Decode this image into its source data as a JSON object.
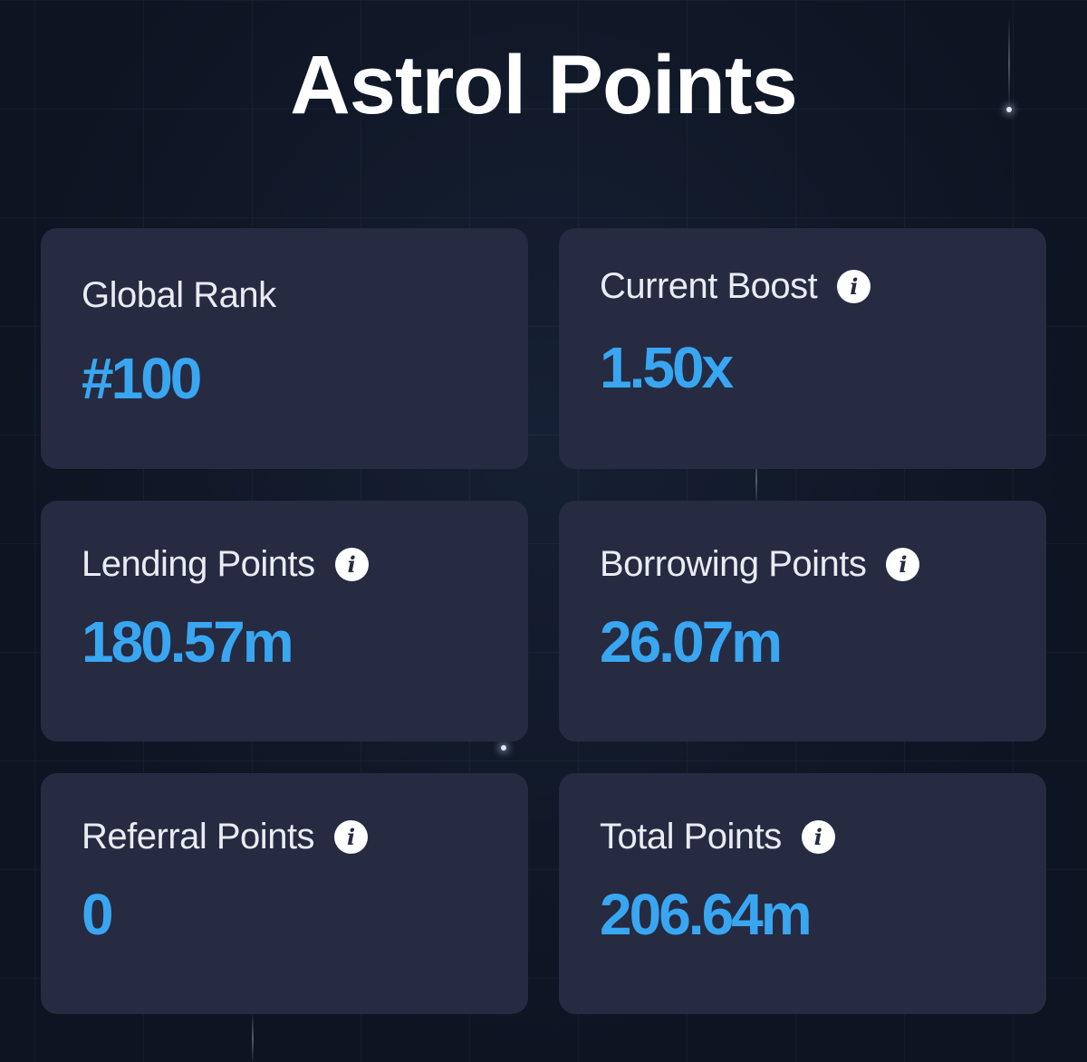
{
  "page": {
    "title": "Astrol Points"
  },
  "theme": {
    "background": "#0d1422",
    "card_background": "#262b42",
    "label_color": "#e9ecf4",
    "value_color": "#39a6f2",
    "info_icon": "info-icon"
  },
  "stats": {
    "global_rank": {
      "label": "Global Rank",
      "value": "#100"
    },
    "current_boost": {
      "label": "Current Boost",
      "value": "1.50x",
      "icon": "info-icon"
    },
    "lending_points": {
      "label": "Lending Points",
      "value": "180.57m",
      "icon": "info-icon"
    },
    "borrowing_points": {
      "label": "Borrowing Points",
      "value": "26.07m",
      "icon": "info-icon"
    },
    "referral_points": {
      "label": "Referral Points",
      "value": "0",
      "icon": "info-icon"
    },
    "total_points": {
      "label": "Total Points",
      "value": "206.64m",
      "icon": "info-icon"
    }
  }
}
